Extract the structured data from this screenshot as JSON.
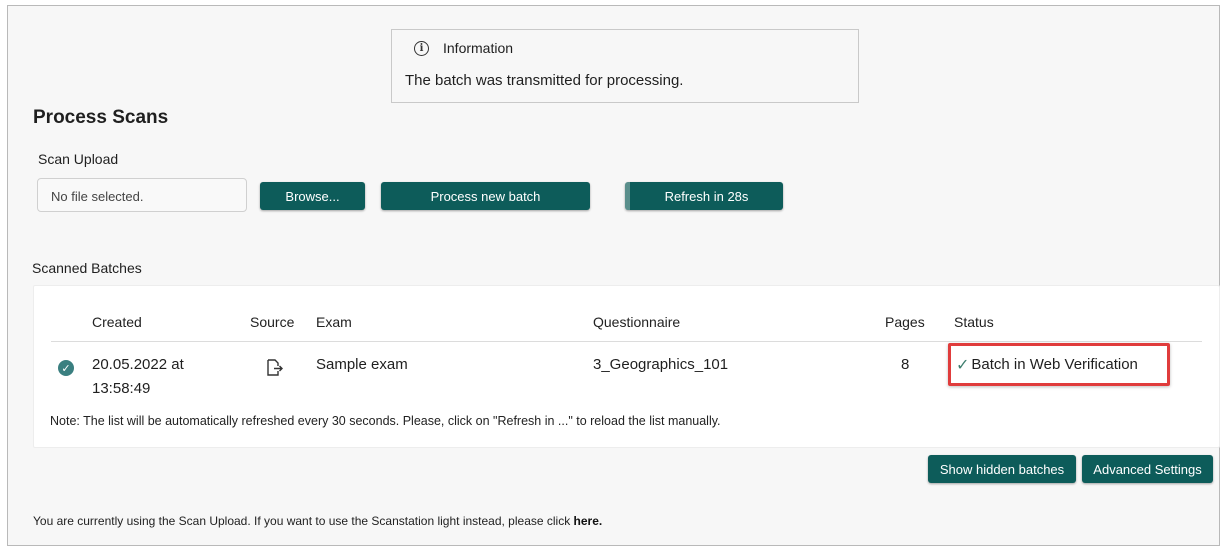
{
  "info": {
    "title": "Information",
    "message": "The batch was transmitted for processing."
  },
  "page_title": "Process Scans",
  "upload": {
    "label": "Scan Upload",
    "file_placeholder": "No file selected.",
    "browse_label": "Browse...",
    "process_label": "Process new batch",
    "refresh_label": "Refresh in 28s"
  },
  "batches": {
    "label": "Scanned Batches",
    "columns": [
      "Created",
      "Source",
      "Exam",
      "Questionnaire",
      "Pages",
      "Status"
    ],
    "rows": [
      {
        "created_date": "20.05.2022 at",
        "created_time": "13:58:49",
        "exam": "Sample exam",
        "questionnaire": "3_Geographics_101",
        "pages": "8",
        "status": "Batch in Web Verification"
      }
    ],
    "note": "Note: The list will be automatically refreshed every 30 seconds. Please, click on \"Refresh in ...\" to reload the list manually."
  },
  "actions": {
    "show_hidden": "Show hidden batches",
    "advanced": "Advanced Settings"
  },
  "footer": {
    "text": "You are currently using the Scan Upload. If you want to use the Scanstation light instead, please click ",
    "link": "here."
  },
  "colors": {
    "accent": "#0d5c5a",
    "highlight": "#e03c3c",
    "status_check": "#3a7f80"
  }
}
